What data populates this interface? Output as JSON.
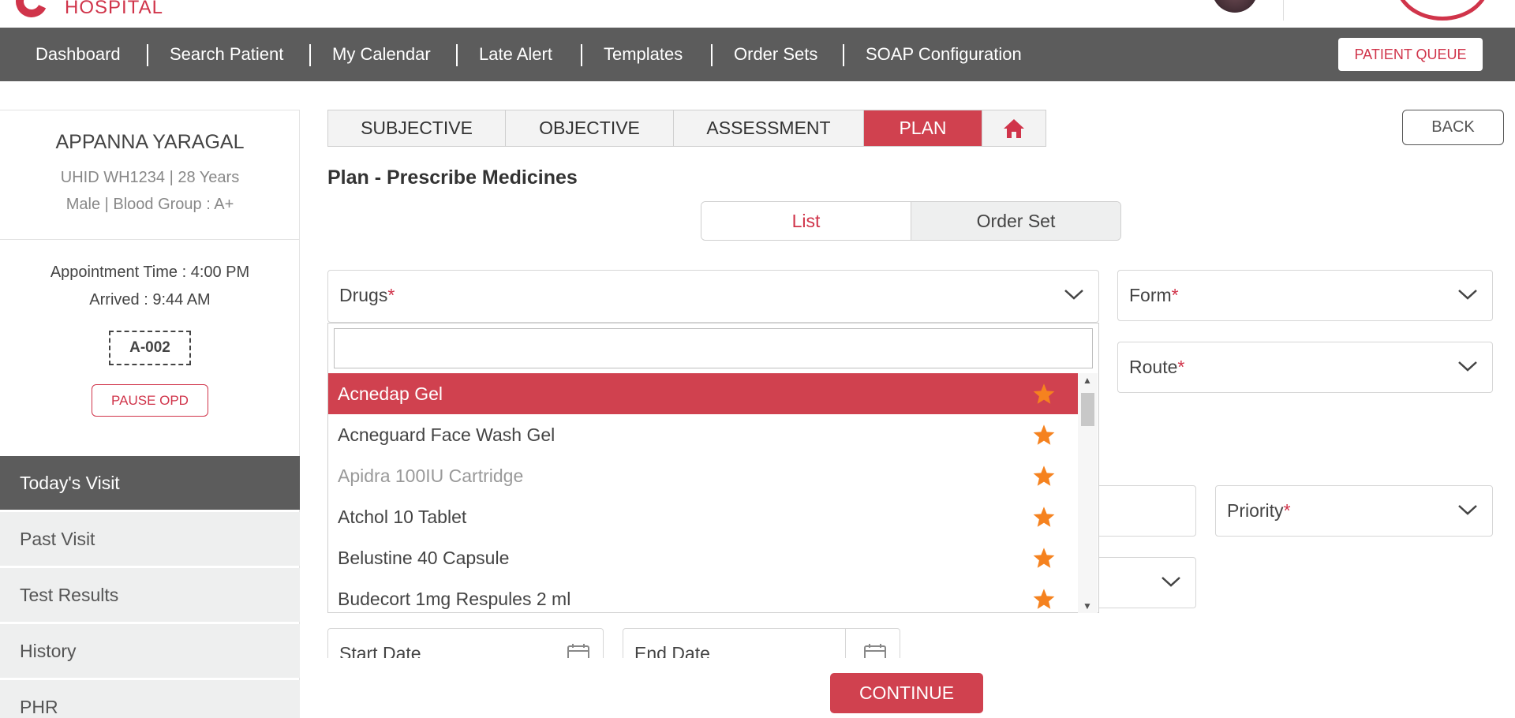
{
  "header": {
    "logo_text": "HOSPITAL",
    "patient_queue_label": "PATIENT QUEUE"
  },
  "nav": {
    "items": [
      {
        "label": "Dashboard"
      },
      {
        "label": "Search Patient"
      },
      {
        "label": "My Calendar"
      },
      {
        "label": "Late Alert"
      },
      {
        "label": "Templates"
      },
      {
        "label": "Order Sets"
      },
      {
        "label": "SOAP Configuration"
      }
    ]
  },
  "patient": {
    "name": "APPANNA YARAGAL",
    "uhid_age": "UHID WH1234 | 28 Years",
    "gender_blood": "Male | Blood Group : A+",
    "appointment_time": "Appointment Time : 4:00 PM",
    "arrived": "Arrived : 9:44 AM",
    "token": "A-002",
    "pause_label": "PAUSE OPD"
  },
  "sidebar": {
    "items": [
      {
        "label": "Today's Visit",
        "active": true
      },
      {
        "label": "Past Visit"
      },
      {
        "label": "Test Results"
      },
      {
        "label": "History"
      },
      {
        "label": "PHR"
      }
    ]
  },
  "tabs": [
    {
      "label": "SUBJECTIVE"
    },
    {
      "label": "OBJECTIVE"
    },
    {
      "label": "ASSESSMENT"
    },
    {
      "label": "PLAN",
      "active": true
    }
  ],
  "back_label": "BACK",
  "section_title": "Plan - Prescribe Medicines",
  "toggle": {
    "list": "List",
    "order_set": "Order Set"
  },
  "fields": {
    "drugs": "Drugs",
    "form": "Form",
    "route": "Route",
    "priority": "Priority",
    "required_mark": "*",
    "start_date": "Start Date",
    "end_date": "End Date"
  },
  "dropdown": {
    "search_value": "",
    "items": [
      {
        "label": "Acnedap Gel",
        "highlighted": true
      },
      {
        "label": "Acneguard Face Wash Gel"
      },
      {
        "label": "Apidra 100IU Cartridge",
        "dimmed": true
      },
      {
        "label": "Atchol 10 Tablet"
      },
      {
        "label": "Belustine 40 Capsule"
      },
      {
        "label": "Budecort 1mg Respules 2 ml"
      }
    ],
    "favorite_icon": "star-icon"
  },
  "continue_label": "CONTINUE",
  "colors": {
    "accent": "#d0414f",
    "nav_bg": "#5c5c5c",
    "star": "#f5821f"
  }
}
